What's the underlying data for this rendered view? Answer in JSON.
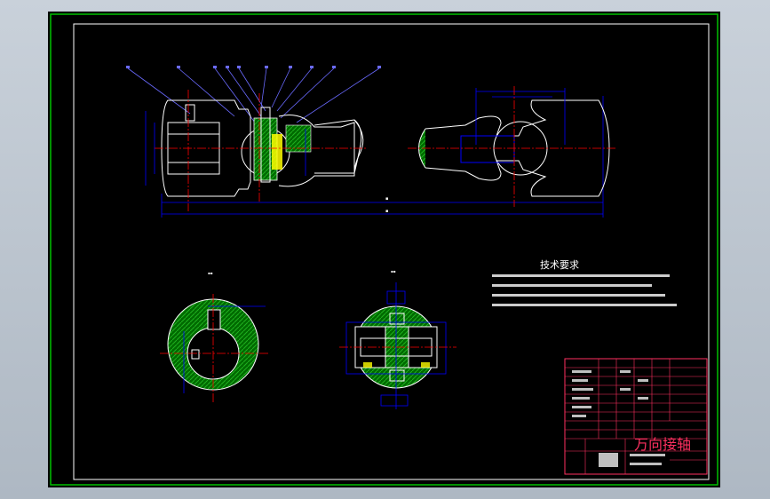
{
  "drawing": {
    "title_block": {
      "drawing_title": "万向接轴"
    },
    "technical_requirements": {
      "heading": "技术要求"
    },
    "colors": {
      "background": "#000000",
      "frame_outer": "#00c000",
      "frame_inner": "#ffffff",
      "part_outline": "#ffffff",
      "dimension": "#0000ff",
      "centerline": "#ff0000",
      "hatch": "#00aa00",
      "leader": "#6a6aff",
      "title_block": "#ff3060",
      "highlight": "#ffff00"
    }
  }
}
